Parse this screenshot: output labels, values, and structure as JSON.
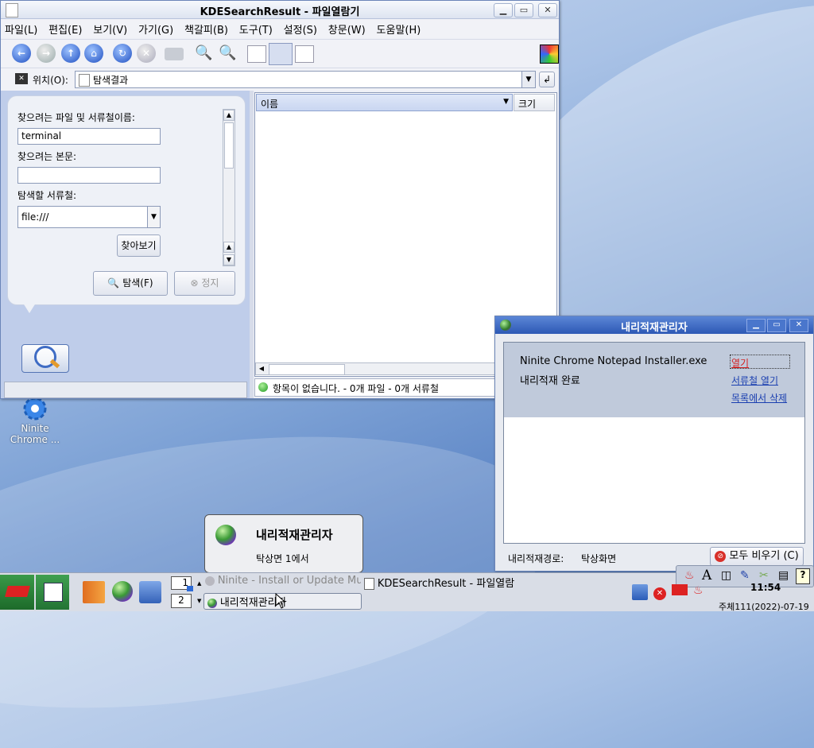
{
  "fm_window": {
    "title": "KDESearchResult - 파일열람기",
    "menu": [
      "파일(L)",
      "편집(E)",
      "보기(V)",
      "가기(G)",
      "책갈피(B)",
      "도구(T)",
      "설정(S)",
      "창문(W)",
      "도움말(H)"
    ],
    "location_label": "위치(O):",
    "location_value": "탐색결과",
    "search_panel": {
      "name_label": "찾으려는 파일 및 서류철이름:",
      "name_value": "terminal",
      "content_label": "찾으려는 본문:",
      "content_value": "",
      "folder_label": "탐색할 서류철:",
      "folder_value": "file:///",
      "browse_button": "찾아보기",
      "search_button": "탐색(F)",
      "stop_button": "정지"
    },
    "columns": [
      "이름",
      "크기"
    ],
    "status_text": "항목이 없습니다. - 0개 파일 - 0개 서류철"
  },
  "desktop_icon": {
    "label_line1": "Ninite",
    "label_line2": "Chrome ..."
  },
  "dl_window": {
    "title": "내리적재관리자",
    "file_name": "Ninite Chrome Notepad Installer.exe",
    "status": "내리적재 완료",
    "open_link": "열기",
    "open_folder_link": "서류철 열기",
    "remove_link": "목록에서 삭제",
    "path_label": "내리적재경로:",
    "path_value": "탁상화면",
    "clear_all_button": "모두 비우기 (C)"
  },
  "notification": {
    "title": "내리적재관리자",
    "body": "탁상면 1에서"
  },
  "taskbar": {
    "desk1": "1",
    "desk2": "2",
    "tasks": [
      "Ninite - Install or Update Mu",
      "KDESearchResult - 파일열람",
      "내리적재관리자"
    ],
    "clock_time": "11:54",
    "clock_date": "주체111(2022)-07-19",
    "tray_letter": "A"
  },
  "colors": {
    "taskbar_bg": "#d9dde6",
    "selection_blue": "#2d55c8",
    "desktop_blue": "#5d86c6"
  }
}
